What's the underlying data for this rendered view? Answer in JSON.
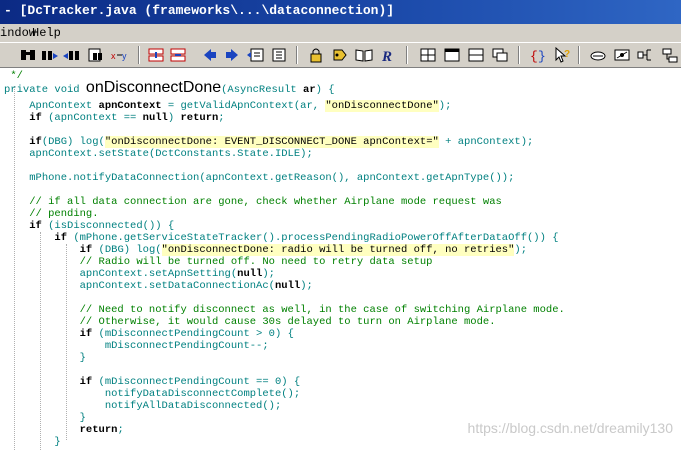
{
  "window": {
    "title": "- [DcTracker.java (frameworks\\...\\dataconnection)]"
  },
  "menu": {
    "items": [
      "indow",
      "Help"
    ]
  },
  "toolbar": {
    "icons": [
      "binoculars-icon",
      "find-next-icon",
      "find-previous-icon",
      "find-in-files-icon",
      "replace-icon",
      "bookmark-prev-icon",
      "bookmark-next-icon",
      "back-arrow-icon",
      "forward-arrow-icon",
      "window-icon",
      "window-list-icon",
      "lock-icon",
      "tag-icon",
      "book-icon",
      "r-icon",
      "grid-icon",
      "window-single-icon",
      "split-horizontal-icon",
      "cascade-icon",
      "braces-icon",
      "cursor-help-icon",
      "tools-icon",
      "paint-icon",
      "node-icon",
      "flow-icon"
    ]
  },
  "code": {
    "lines": [
      {
        "indent": " ",
        "tokens": [
          {
            "t": "*/",
            "c": "cm"
          }
        ]
      },
      {
        "indent": "",
        "tokens": [
          {
            "t": "private void ",
            "c": "tl"
          },
          {
            "t": "onDisconnectDone",
            "c": "fn"
          },
          {
            "t": "(AsyncResult ",
            "c": "tl"
          },
          {
            "t": "ar",
            "c": "kw"
          },
          {
            "t": ") {",
            "c": "tl"
          }
        ]
      },
      {
        "indent": "    ",
        "tokens": [
          {
            "t": "ApnContext ",
            "c": "tl"
          },
          {
            "t": "apnContext",
            "c": "kw"
          },
          {
            "t": " = getValidApnContext(ar, ",
            "c": "tl"
          },
          {
            "t": "\"onDisconnectDone\"",
            "c": "str"
          },
          {
            "t": ");",
            "c": "tl"
          }
        ]
      },
      {
        "indent": "    ",
        "tokens": [
          {
            "t": "if",
            "c": "kw"
          },
          {
            "t": " (apnContext == ",
            "c": "tl"
          },
          {
            "t": "null",
            "c": "kw"
          },
          {
            "t": ") ",
            "c": "tl"
          },
          {
            "t": "return",
            "c": "kw"
          },
          {
            "t": ";",
            "c": "tl"
          }
        ]
      },
      {
        "indent": "",
        "tokens": []
      },
      {
        "indent": "    ",
        "tokens": [
          {
            "t": "if",
            "c": "kw"
          },
          {
            "t": "(DBG) log(",
            "c": "tl"
          },
          {
            "t": "\"onDisconnectDone: EVENT_DISCONNECT_DONE apnContext=\"",
            "c": "str"
          },
          {
            "t": " + apnContext);",
            "c": "tl"
          }
        ]
      },
      {
        "indent": "    ",
        "tokens": [
          {
            "t": "apnContext.setState(DctConstants.State.IDLE);",
            "c": "tl"
          }
        ]
      },
      {
        "indent": "",
        "tokens": []
      },
      {
        "indent": "    ",
        "tokens": [
          {
            "t": "mPhone.notifyDataConnection(apnContext.getReason(), apnContext.getApnType());",
            "c": "tl"
          }
        ]
      },
      {
        "indent": "",
        "tokens": []
      },
      {
        "indent": "    ",
        "tokens": [
          {
            "t": "// if all data connection are gone, check whether Airplane mode request was",
            "c": "cm"
          }
        ]
      },
      {
        "indent": "    ",
        "tokens": [
          {
            "t": "// pending.",
            "c": "cm"
          }
        ]
      },
      {
        "indent": "    ",
        "tokens": [
          {
            "t": "if",
            "c": "kw"
          },
          {
            "t": " (isDisconnected()) {",
            "c": "tl"
          }
        ]
      },
      {
        "indent": "        ",
        "tokens": [
          {
            "t": "if",
            "c": "kw"
          },
          {
            "t": " (mPhone.getServiceStateTracker().processPendingRadioPowerOffAfterDataOff()) {",
            "c": "tl"
          }
        ]
      },
      {
        "indent": "            ",
        "tokens": [
          {
            "t": "if",
            "c": "kw"
          },
          {
            "t": " (DBG) log(",
            "c": "tl"
          },
          {
            "t": "\"onDisconnectDone: radio will be turned off, no retries\"",
            "c": "str"
          },
          {
            "t": ");",
            "c": "tl"
          }
        ]
      },
      {
        "indent": "            ",
        "tokens": [
          {
            "t": "// Radio will be turned off. No need to retry data setup",
            "c": "cm"
          }
        ]
      },
      {
        "indent": "            ",
        "tokens": [
          {
            "t": "apnContext.setApnSetting(",
            "c": "tl"
          },
          {
            "t": "null",
            "c": "kw"
          },
          {
            "t": ");",
            "c": "tl"
          }
        ]
      },
      {
        "indent": "            ",
        "tokens": [
          {
            "t": "apnContext.setDataConnectionAc(",
            "c": "tl"
          },
          {
            "t": "null",
            "c": "kw"
          },
          {
            "t": ");",
            "c": "tl"
          }
        ]
      },
      {
        "indent": "",
        "tokens": []
      },
      {
        "indent": "            ",
        "tokens": [
          {
            "t": "// Need to notify disconnect as well, in the case of switching Airplane mode.",
            "c": "cm"
          }
        ]
      },
      {
        "indent": "            ",
        "tokens": [
          {
            "t": "// Otherwise, it would cause 30s delayed to turn on Airplane mode.",
            "c": "cm"
          }
        ]
      },
      {
        "indent": "            ",
        "tokens": [
          {
            "t": "if",
            "c": "kw"
          },
          {
            "t": " (mDisconnectPendingCount > 0) {",
            "c": "tl"
          }
        ]
      },
      {
        "indent": "                ",
        "tokens": [
          {
            "t": "mDisconnectPendingCount--;",
            "c": "tl"
          }
        ]
      },
      {
        "indent": "            ",
        "tokens": [
          {
            "t": "}",
            "c": "tl"
          }
        ]
      },
      {
        "indent": "",
        "tokens": []
      },
      {
        "indent": "            ",
        "tokens": [
          {
            "t": "if",
            "c": "kw"
          },
          {
            "t": " (mDisconnectPendingCount == 0) {",
            "c": "tl"
          }
        ]
      },
      {
        "indent": "                ",
        "tokens": [
          {
            "t": "notifyDataDisconnectComplete();",
            "c": "tl"
          }
        ]
      },
      {
        "indent": "                ",
        "tokens": [
          {
            "t": "notifyAllDataDisconnected();",
            "c": "tl"
          }
        ]
      },
      {
        "indent": "            ",
        "tokens": [
          {
            "t": "}",
            "c": "tl"
          }
        ]
      },
      {
        "indent": "            ",
        "tokens": [
          {
            "t": "return",
            "c": "kw"
          },
          {
            "t": ";",
            "c": "tl"
          }
        ]
      },
      {
        "indent": "        ",
        "tokens": [
          {
            "t": "}",
            "c": "tl"
          }
        ]
      }
    ]
  },
  "watermark": "https://blog.csdn.net/dreamily130",
  "colors": {
    "titlebar": "#0b2a84",
    "chrome": "#d4d0c8",
    "keyword": "#000000",
    "code_teal": "#008080",
    "comment": "#008000",
    "string_bg": "#ffffc0"
  }
}
